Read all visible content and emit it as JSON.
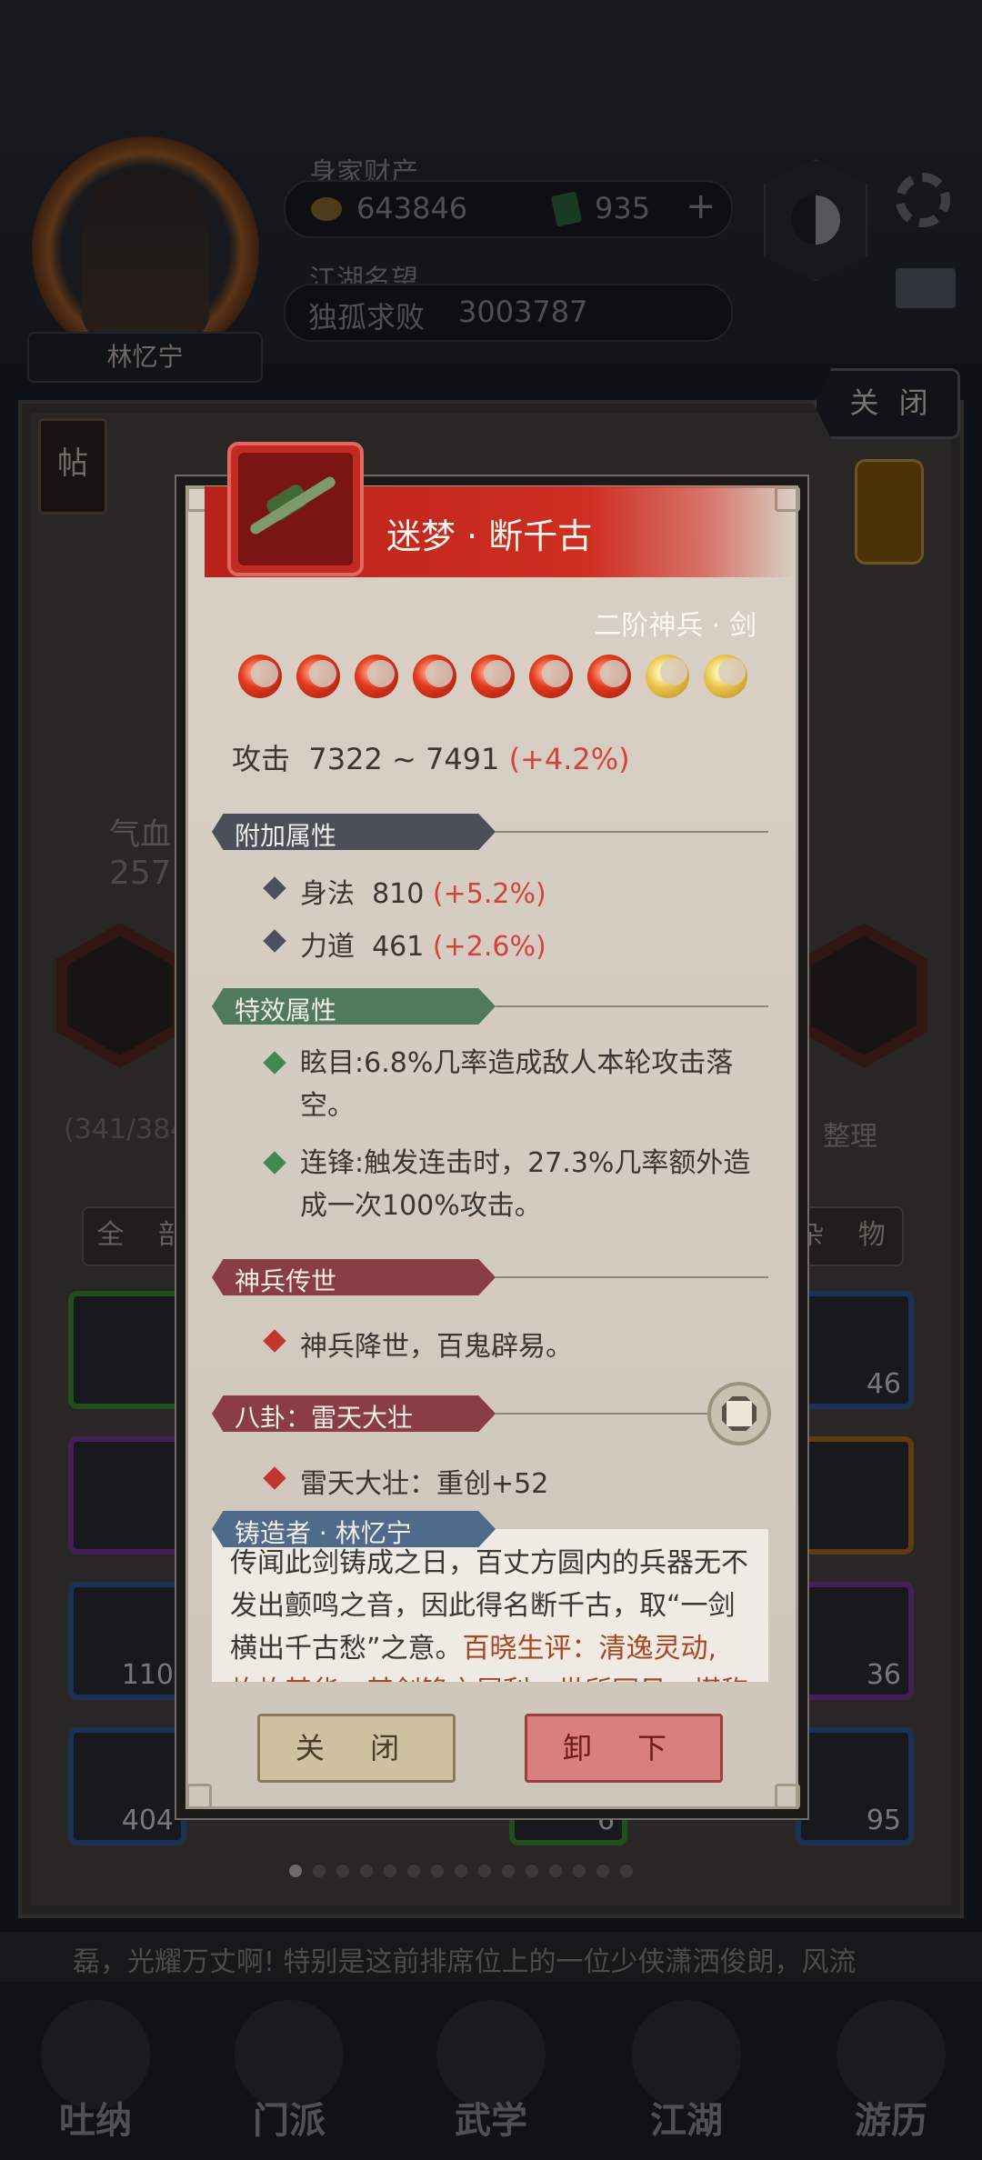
{
  "header": {
    "player_name": "林忆宁",
    "wealth_label": "身家财产",
    "coins": "643846",
    "tickets": "935",
    "add_symbol": "+",
    "reputation_label": "江湖名望",
    "title": "独孤求败",
    "reputation_value": "3003787"
  },
  "panel": {
    "close_tag": "关 闭",
    "tie_label": "帖",
    "hp_label": "气血",
    "hp_value": "257",
    "inventory_count": "(341/384",
    "sort_label": "整理",
    "filter_all": "全 部",
    "filter_misc": "杂 物",
    "slot_counts": [
      "46",
      "110",
      "36",
      "404",
      "6",
      "95"
    ]
  },
  "ticker": "磊，光耀万丈啊! 特别是这前排席位上的一位少侠潇洒俊朗，风流",
  "nav": [
    "吐纳",
    "门派",
    "武学",
    "江湖",
    "游历"
  ],
  "item": {
    "name": "迷梦 · 断千古",
    "tier": "二阶神兵 · 剑",
    "stars": [
      "red",
      "red",
      "red",
      "red",
      "red",
      "red",
      "red",
      "gold",
      "gold"
    ],
    "attack_label": "攻击",
    "attack_range": "7322 ~ 7491",
    "attack_bonus": "(+4.2%)",
    "sections": {
      "extra": "附加属性",
      "special": "特效属性",
      "legend": "神兵传世",
      "bagua": "八卦：雷天大壮",
      "forger": "铸造者 · 林忆宁"
    },
    "extra_attrs": [
      {
        "name": "身法",
        "value": "810",
        "bonus": "(+5.2%)"
      },
      {
        "name": "力道",
        "value": "461",
        "bonus": "(+2.6%)"
      }
    ],
    "effects": [
      "眩目:6.8%几率造成敌人本轮攻击落空。",
      "连锋:触发连击时，27.3%几率额外造成一次100%攻击。"
    ],
    "legend_text": "神兵降世，百鬼辟易。",
    "bagua_text": "雷天大壮：重创+52",
    "lore": "传闻此剑铸成之日，百丈方圆内的兵器无不发出颤鸣之音，因此得名断千古，取“一剑横出千古愁”之意。",
    "lore_highlight": "百晓生评：清逸灵动, 灼灼其华，其剑锋之犀利，世所罕见，堪称神物。"
  },
  "buttons": {
    "close": "关 闭",
    "unequip": "卸 下"
  },
  "colors": {
    "title_band": "#cf2e22",
    "bonus_red": "#d2443a",
    "paper": "#d9d0c5"
  }
}
